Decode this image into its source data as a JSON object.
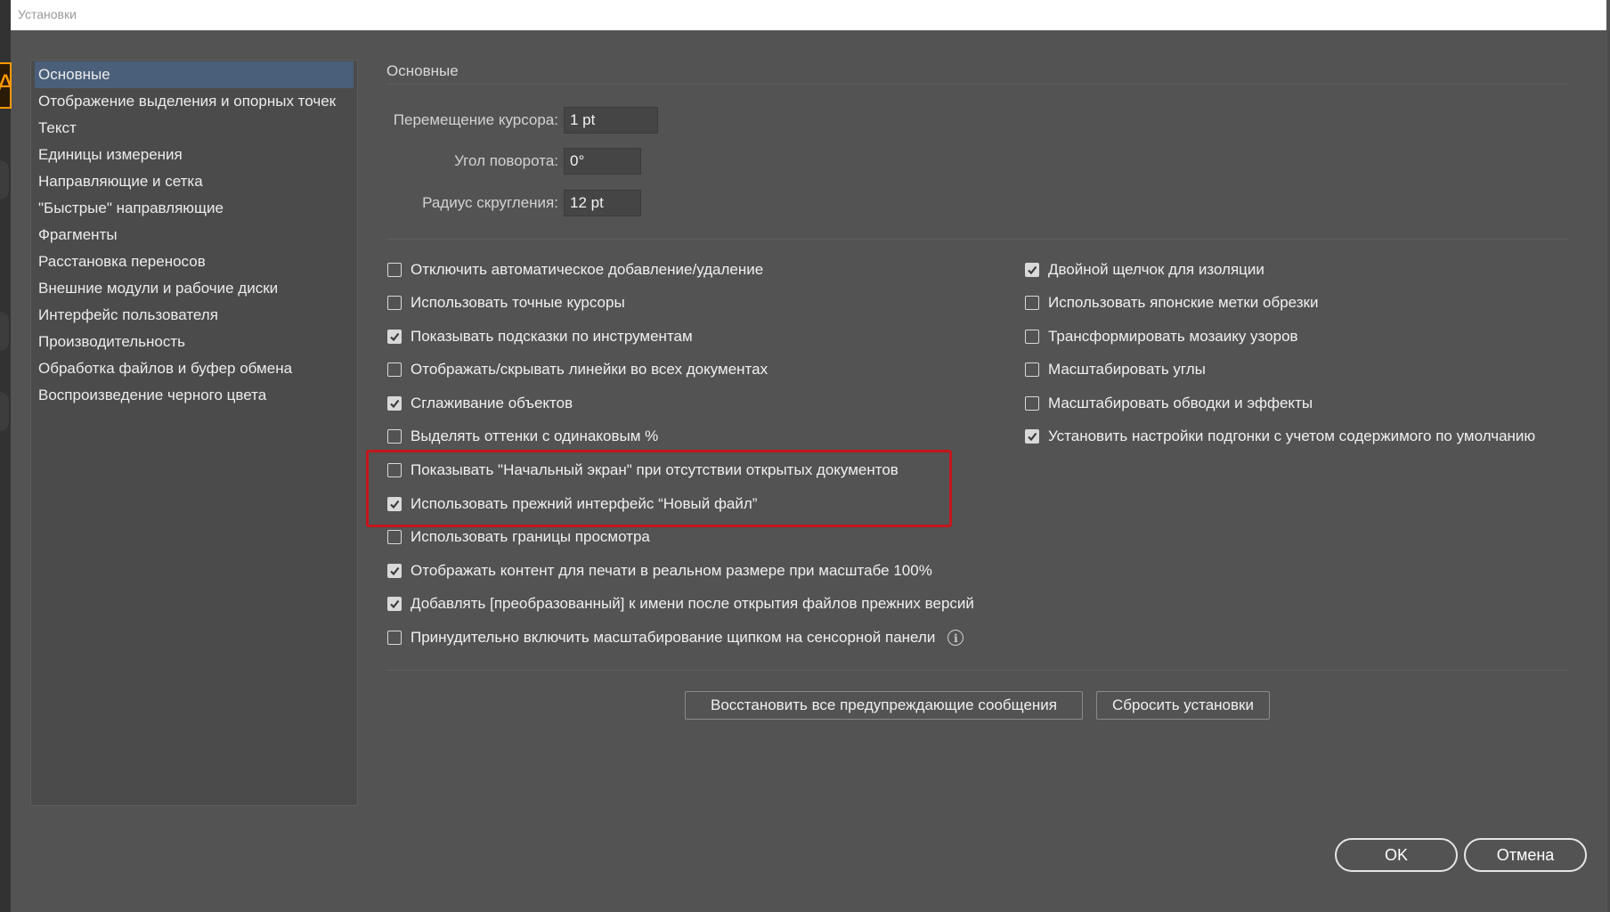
{
  "window": {
    "title": "Установки"
  },
  "app_logo_letter": "A",
  "sidebar": {
    "items": [
      {
        "label": "Основные",
        "active": true
      },
      {
        "label": "Отображение выделения и опорных точек"
      },
      {
        "label": "Текст"
      },
      {
        "label": "Единицы измерения"
      },
      {
        "label": "Направляющие и сетка"
      },
      {
        "label": "\"Быстрые\" направляющие"
      },
      {
        "label": "Фрагменты"
      },
      {
        "label": "Расстановка переносов"
      },
      {
        "label": "Внешние модули и рабочие диски"
      },
      {
        "label": "Интерфейс пользователя"
      },
      {
        "label": "Производительность"
      },
      {
        "label": "Обработка файлов и буфер обмена"
      },
      {
        "label": "Воспроизведение черного цвета"
      }
    ]
  },
  "main": {
    "section_title": "Основные",
    "fields": {
      "cursor_key": {
        "label": "Перемещение курсора:",
        "value": "1 pt"
      },
      "rotation": {
        "label": "Угол поворота:",
        "value": "0°"
      },
      "corner_radius": {
        "label": "Радиус скругления:",
        "value": "12 pt"
      }
    },
    "left_options": [
      {
        "label": "Отключить автоматическое добавление/удаление",
        "checked": false
      },
      {
        "label": "Использовать точные курсоры",
        "checked": false
      },
      {
        "label": "Показывать подсказки по инструментам",
        "checked": true
      },
      {
        "label": "Отображать/скрывать линейки во всех документах",
        "checked": false
      },
      {
        "label": "Сглаживание объектов",
        "checked": true
      },
      {
        "label": "Выделять оттенки с одинаковым %",
        "checked": false
      },
      {
        "label": "Показывать \"Начальный экран\" при отсутствии открытых документов",
        "checked": false
      },
      {
        "label": "Использовать прежний интерфейс “Новый файл”",
        "checked": true
      },
      {
        "label": "Использовать границы просмотра",
        "checked": false
      },
      {
        "label": "Отображать контент для печати в реальном размере при масштабе 100%",
        "checked": true
      },
      {
        "label": "Добавлять [преобразованный] к имени после открытия файлов прежних версий",
        "checked": true
      },
      {
        "label": "Принудительно включить масштабирование щипком на сенсорной панели",
        "checked": false,
        "info": "i"
      }
    ],
    "right_options": [
      {
        "label": "Двойной щелчок для изоляции",
        "checked": true
      },
      {
        "label": "Использовать японские метки обрезки",
        "checked": false
      },
      {
        "label": "Трансформировать мозаику узоров",
        "checked": false
      },
      {
        "label": "Масштабировать углы",
        "checked": false
      },
      {
        "label": "Масштабировать обводки и эффекты",
        "checked": false
      },
      {
        "label": "Установить настройки подгонки с учетом содержимого по умолчанию",
        "checked": true
      }
    ],
    "buttons": {
      "reset_warnings": "Восстановить все предупреждающие сообщения",
      "reset_prefs": "Сбросить установки"
    }
  },
  "footer": {
    "ok": "OK",
    "cancel": "Отмена"
  },
  "colors": {
    "background": "#535353",
    "sidebar_active": "#4a5f79",
    "highlight_border": "#c4161c",
    "app_accent": "#ff9a00"
  }
}
